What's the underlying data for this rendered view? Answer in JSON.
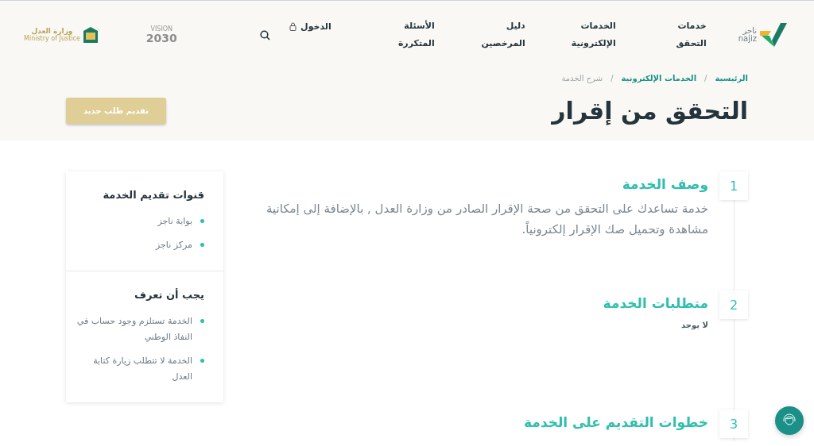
{
  "header": {
    "logo": {
      "arabic": "ناجز",
      "latin": "najiz"
    },
    "nav": [
      {
        "label": "خدمات التحقق"
      },
      {
        "label": "الخدمات الإلكترونية"
      },
      {
        "label": "دليل المرخصين"
      },
      {
        "label": "الأسئلة المتكررة"
      }
    ],
    "login": "الدخول",
    "partner_logos": {
      "vision": {
        "top": "VISION",
        "year": "2030"
      },
      "ministry": {
        "arabic": "وزارة العدل",
        "latin": "Ministry of Justice"
      }
    }
  },
  "breadcrumb_separator": "/",
  "breadcrumb": [
    {
      "label": "الرئيسية",
      "current": false
    },
    {
      "label": "الخدمات الإلكترونية",
      "current": false
    },
    {
      "label": "شرح الخدمة",
      "current": true
    }
  ],
  "page_title": "التحقق من إقرار",
  "new_request_button": "تقديم طلب جديد",
  "steps": [
    {
      "number": "1",
      "title": "وصف الخدمة",
      "kind": "paragraph",
      "body": "خدمة تساعدك على التحقق من صحة الإقرار الصادر من وزارة العدل , بالإضافة إلى إمكانية مشاهدة وتحميل صك الإقرار إلكترونياً."
    },
    {
      "number": "2",
      "title": "متطلبات الخدمة",
      "kind": "note",
      "body": "لا يوجد"
    },
    {
      "number": "3",
      "title": "خطوات التقديم على الخدمة",
      "kind": "none"
    }
  ],
  "sidebar": [
    {
      "title": "قنوات تقديم الخدمة",
      "items": [
        "بوابة ناجز",
        "مركز ناجز"
      ]
    },
    {
      "title": "يجب أن تعرف",
      "items": [
        "الخدمة تستلزم وجود حساب في النفاذ الوطني",
        "الخدمة لا تتطلب زيارة كتابة العدل"
      ]
    }
  ]
}
